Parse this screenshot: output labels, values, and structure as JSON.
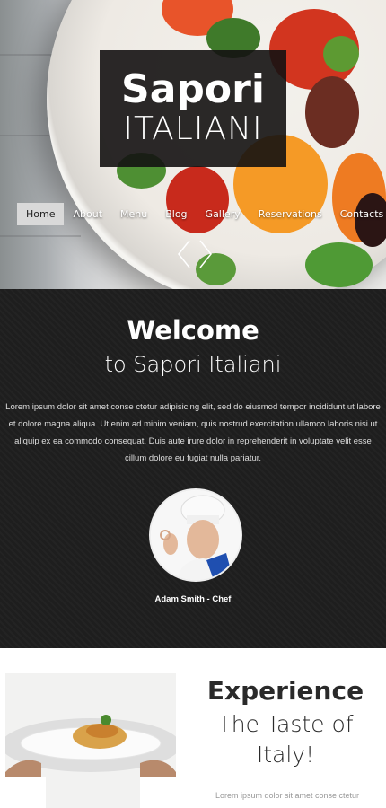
{
  "logo": {
    "line1": "Sapori",
    "line2": "ITALIANI"
  },
  "nav": {
    "items": [
      {
        "label": "Home",
        "active": true
      },
      {
        "label": "About"
      },
      {
        "label": "Menu"
      },
      {
        "label": "Blog"
      },
      {
        "label": "Gallery"
      },
      {
        "label": "Reservations"
      },
      {
        "label": "Contacts"
      }
    ]
  },
  "slider": {
    "prev_icon": "chevron-left-icon",
    "next_icon": "chevron-right-icon"
  },
  "welcome": {
    "title": "Welcome",
    "subtitle": "to Sapori Italiani",
    "text": "Lorem ipsum dolor sit amet conse ctetur adipisicing elit, sed do eiusmod tempor incididunt ut labore et dolore magna aliqua. Ut enim ad minim veniam, quis nostrud exercitation ullamco laboris nisi ut aliquip ex ea commodo consequat. Duis aute irure dolor in reprehenderit in voluptate velit esse cillum dolore eu fugiat nulla pariatur.",
    "chef_name": "Adam Smith - Chef"
  },
  "experience": {
    "title": "Experience",
    "subtitle_line1": "The Taste of",
    "subtitle_line2": "Italy!",
    "text": "Lorem ipsum dolor sit amet conse ctetur"
  },
  "colors": {
    "dark_bg": "#1e1e1e",
    "nav_active": "#d9d9d9"
  }
}
